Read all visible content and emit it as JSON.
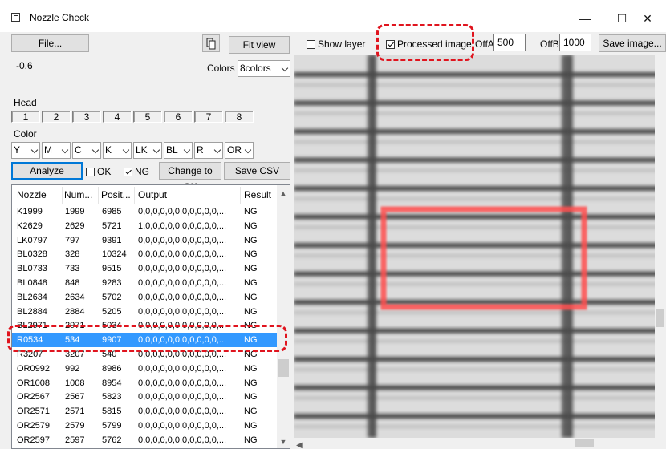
{
  "window": {
    "title": "Nozzle Check",
    "minimize": "—",
    "maximize": "☐",
    "close": "✕"
  },
  "toolbar": {
    "file_label": "File...",
    "fit_view_label": "Fit view",
    "show_layer_label": "Show layer",
    "show_layer_checked": false,
    "processed_image_label": "Processed image",
    "processed_image_checked": true,
    "offa_label": "OffA",
    "offa_value": "500",
    "offb_label": "OffB",
    "offb_value": "1000",
    "save_image_label": "Save image...",
    "value_readout": "-0.6",
    "colors_label": "Colors",
    "colors_value": "8colors"
  },
  "head": {
    "label": "Head",
    "buttons": [
      "1",
      "2",
      "3",
      "4",
      "5",
      "6",
      "7",
      "8"
    ]
  },
  "color": {
    "label": "Color",
    "selects": [
      "Y",
      "M",
      "C",
      "K",
      "LK",
      "BL",
      "R",
      "OR"
    ]
  },
  "actions": {
    "analyze_label": "Analyze",
    "ok_label": "OK",
    "ok_checked": false,
    "ng_label": "NG",
    "ng_checked": true,
    "change_to_ok_label": "Change to OK",
    "save_csv_label": "Save CSV"
  },
  "table": {
    "columns": [
      "Nozzle",
      "Num...",
      "Posit...",
      "Output",
      "Result"
    ],
    "rows": [
      {
        "nozzle": "K1999",
        "num": "1999",
        "pos": "6985",
        "output": "0,0,0,0,0,0,0,0,0,0,0,...",
        "result": "NG"
      },
      {
        "nozzle": "K2629",
        "num": "2629",
        "pos": "5721",
        "output": "1,0,0,0,0,0,0,0,0,0,0,...",
        "result": "NG"
      },
      {
        "nozzle": "LK0797",
        "num": "797",
        "pos": "9391",
        "output": "0,0,0,0,0,0,0,0,0,0,0,...",
        "result": "NG"
      },
      {
        "nozzle": "BL0328",
        "num": "328",
        "pos": "10324",
        "output": "0,0,0,0,0,0,0,0,0,0,0,...",
        "result": "NG"
      },
      {
        "nozzle": "BL0733",
        "num": "733",
        "pos": "9515",
        "output": "0,0,0,0,0,0,0,0,0,0,0,...",
        "result": "NG"
      },
      {
        "nozzle": "BL0848",
        "num": "848",
        "pos": "9283",
        "output": "0,0,0,0,0,0,0,0,0,0,0,...",
        "result": "NG"
      },
      {
        "nozzle": "BL2634",
        "num": "2634",
        "pos": "5702",
        "output": "0,0,0,0,0,0,0,0,0,0,0,...",
        "result": "NG"
      },
      {
        "nozzle": "BL2884",
        "num": "2884",
        "pos": "5205",
        "output": "0,0,0,0,0,0,0,0,0,0,0,...",
        "result": "NG"
      },
      {
        "nozzle": "BL2971",
        "num": "2971",
        "pos": "5034",
        "output": "0,0,0,0,0,0,0,0,0,0,0,...",
        "result": "NG"
      },
      {
        "nozzle": "R0534",
        "num": "534",
        "pos": "9907",
        "output": "0,0,0,0,0,0,0,0,0,0,0,...",
        "result": "NG",
        "selected": true
      },
      {
        "nozzle": "R3207",
        "num": "3207",
        "pos": "540",
        "output": "0,0,0,0,0,0,0,0,0,0,0,...",
        "result": "NG"
      },
      {
        "nozzle": "OR0992",
        "num": "992",
        "pos": "8986",
        "output": "0,0,0,0,0,0,0,0,0,0,0,...",
        "result": "NG"
      },
      {
        "nozzle": "OR1008",
        "num": "1008",
        "pos": "8954",
        "output": "0,0,0,0,0,0,0,0,0,0,0,...",
        "result": "NG"
      },
      {
        "nozzle": "OR2567",
        "num": "2567",
        "pos": "5823",
        "output": "0,0,0,0,0,0,0,0,0,0,0,...",
        "result": "NG"
      },
      {
        "nozzle": "OR2571",
        "num": "2571",
        "pos": "5815",
        "output": "0,0,0,0,0,0,0,0,0,0,0,...",
        "result": "NG"
      },
      {
        "nozzle": "OR2579",
        "num": "2579",
        "pos": "5799",
        "output": "0,0,0,0,0,0,0,0,0,0,0,...",
        "result": "NG"
      },
      {
        "nozzle": "OR2597",
        "num": "2597",
        "pos": "5762",
        "output": "0,0,0,0,0,0,0,0,0,0,0,...",
        "result": "NG"
      }
    ]
  },
  "colors": {
    "accent": "#0078d7",
    "selection": "#3399ff",
    "highlight": "#e0141e",
    "detection_box": "#ff5050"
  },
  "icons": {
    "app": "window-icon",
    "view_toggle": "rotate-icon"
  }
}
